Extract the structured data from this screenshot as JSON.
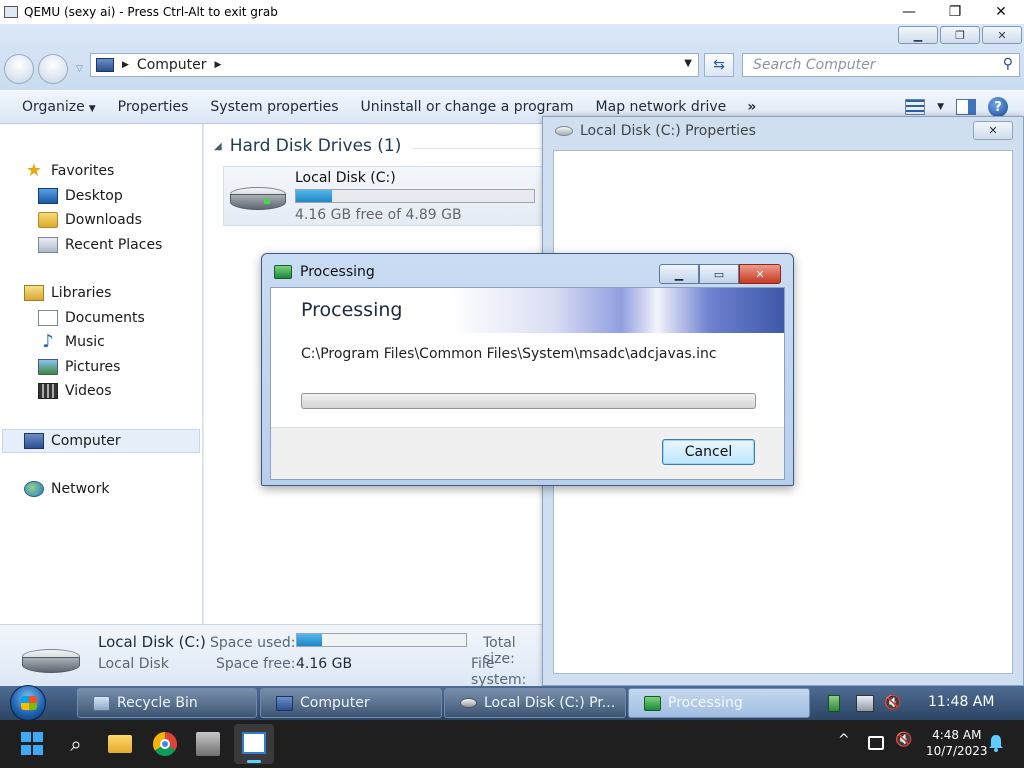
{
  "host": {
    "title": "QEMU (sexy ai) - Press Ctrl-Alt to exit grab",
    "minimize": "—",
    "maximize": "❐",
    "close": "✕"
  },
  "explorer": {
    "address": {
      "location": "Computer"
    },
    "search": {
      "placeholder": "Search Computer"
    },
    "toolbar": {
      "organize": "Organize",
      "properties": "Properties",
      "system_properties": "System properties",
      "uninstall": "Uninstall or change a program",
      "map_drive": "Map network drive",
      "more": "»"
    },
    "nav": {
      "favorites": "Favorites",
      "desktop": "Desktop",
      "downloads": "Downloads",
      "recent_places": "Recent Places",
      "libraries": "Libraries",
      "documents": "Documents",
      "music": "Music",
      "pictures": "Pictures",
      "videos": "Videos",
      "computer": "Computer",
      "network": "Network"
    },
    "group": {
      "title": "Hard Disk Drives (1)"
    },
    "drive": {
      "name": "Local Disk (C:)",
      "free_text": "4.16 GB free of 4.89 GB",
      "used_fraction": 0.15
    },
    "details": {
      "name": "Local Disk (C:)",
      "type": "Local Disk",
      "space_used_label": "Space used:",
      "space_free_label": "Space free:",
      "space_free_value": "4.16 GB",
      "total_size_label": "Total size:",
      "file_system_label": "File system:"
    }
  },
  "properties_window": {
    "title": "Local Disk (C:) Properties",
    "close": "✕"
  },
  "processing_dialog": {
    "title": "Processing",
    "heading": "Processing",
    "file_path": "C:\\Program Files\\Common Files\\System\\msadc\\adcjavas.inc",
    "progress_fraction": 0.0,
    "cancel_label": "Cancel"
  },
  "guest_taskbar": {
    "items": [
      {
        "label": "Recycle Bin"
      },
      {
        "label": "Computer"
      },
      {
        "label": "Local Disk (C:) Pr..."
      },
      {
        "label": "Processing"
      }
    ],
    "clock": "11:48 AM"
  },
  "host_taskbar": {
    "time": "4:48 AM",
    "date": "10/7/2023",
    "tray_chevron": "^"
  },
  "colors": {
    "explorer_chrome": "#dbe8f7",
    "win7_taskbar": "#2d4565",
    "host_taskbar": "#1f1f1f",
    "progress_fill": "#1f86c7",
    "close_red": "#c53a23"
  }
}
